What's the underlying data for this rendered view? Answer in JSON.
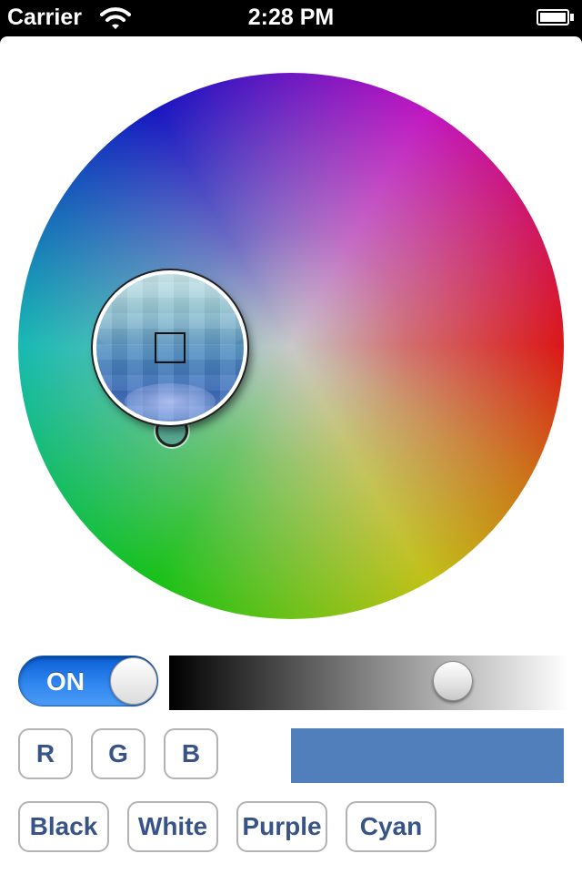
{
  "status_bar": {
    "carrier": "Carrier",
    "time": "2:28 PM",
    "wifi_icon": "wifi-icon",
    "battery_icon": "battery-icon"
  },
  "color_wheel": {
    "selected_color": "#507fbb"
  },
  "brightness_switch": {
    "label": "ON",
    "state": "on",
    "color": "#1a6fe0"
  },
  "brightness_slider": {
    "value": 0.71
  },
  "channel_buttons": [
    {
      "label": "R"
    },
    {
      "label": "G"
    },
    {
      "label": "B"
    }
  ],
  "preset_buttons": [
    {
      "label": "Black"
    },
    {
      "label": "White"
    },
    {
      "label": "Purple"
    },
    {
      "label": "Cyan"
    }
  ],
  "colors": {
    "button_text": "#385487",
    "button_border": "#b3b3b3"
  }
}
